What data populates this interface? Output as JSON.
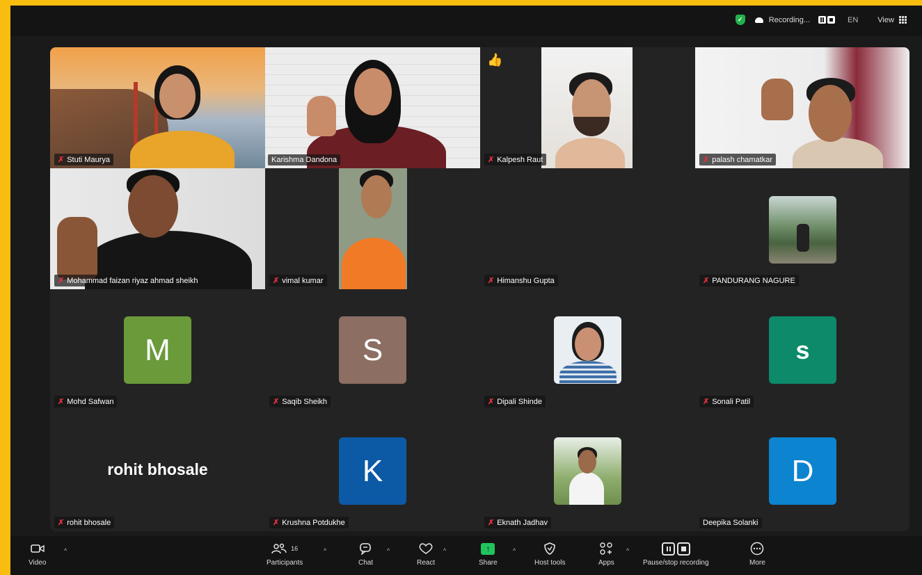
{
  "topbar": {
    "recording_label": "Recording...",
    "language": "EN",
    "view_label": "View"
  },
  "participants": [
    {
      "name": "Stuti Maurya",
      "kind": "video",
      "muted": true
    },
    {
      "name": "Karishma Dandona",
      "kind": "video",
      "muted": false,
      "active_speaker": true
    },
    {
      "name": "Kalpesh Raut",
      "kind": "video",
      "muted": true,
      "reaction": "thumbs-up"
    },
    {
      "name": "palash chamatkar",
      "kind": "video",
      "muted": true
    },
    {
      "name": "Mohammad faizan riyaz ahmad sheikh",
      "kind": "video",
      "muted": true
    },
    {
      "name": "vimal kumar",
      "kind": "video",
      "muted": true
    },
    {
      "name": "Himanshu Gupta",
      "kind": "none",
      "muted": true
    },
    {
      "name": "PANDURANG NAGURE",
      "kind": "photo",
      "muted": true
    },
    {
      "name": "Mohd Safwan",
      "kind": "letter",
      "letter": "M",
      "color": "#6a9a3a",
      "muted": true
    },
    {
      "name": "Saqib Sheikh",
      "kind": "letter",
      "letter": "S",
      "color": "#8c6e63",
      "muted": true
    },
    {
      "name": "Dipali Shinde",
      "kind": "photo",
      "muted": true
    },
    {
      "name": "Sonali Patil",
      "kind": "letter",
      "letter": "s",
      "color": "#0d8a6a",
      "muted": true
    },
    {
      "name": "rohit bhosale",
      "kind": "bigname",
      "display": "rohit bhosale",
      "muted": true
    },
    {
      "name": "Krushna Potdukhe",
      "kind": "letter",
      "letter": "K",
      "color": "#0c5aa6",
      "muted": true
    },
    {
      "name": "Eknath Jadhav",
      "kind": "photo",
      "muted": true
    },
    {
      "name": "Deepika Solanki",
      "kind": "letter",
      "letter": "D",
      "color": "#0d84d0",
      "muted": false
    }
  ],
  "toolbar": {
    "video_label": "Video",
    "participants_label": "Participants",
    "participants_count": "16",
    "chat_label": "Chat",
    "react_label": "React",
    "share_label": "Share",
    "host_tools_label": "Host tools",
    "apps_label": "Apps",
    "pause_stop_label": "Pause/stop recording",
    "more_label": "More"
  }
}
